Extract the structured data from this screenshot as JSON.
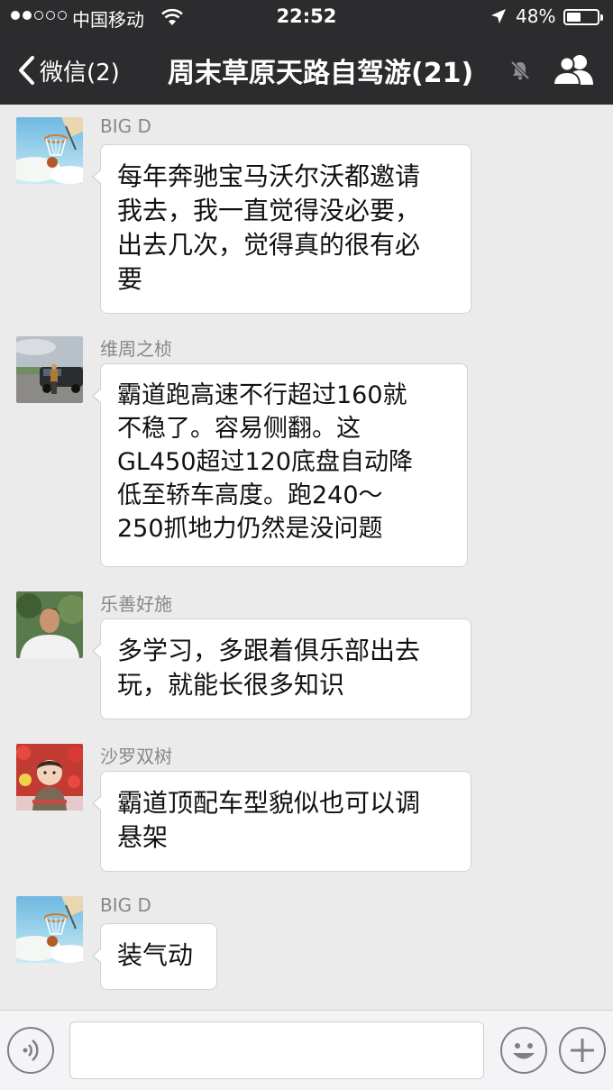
{
  "status_bar": {
    "carrier": "中国移动",
    "time": "22:52",
    "battery": "48%",
    "battery_level": 0.48,
    "signal_bars_filled": 2,
    "signal_bars_total": 5
  },
  "nav": {
    "back_label": "微信(2)",
    "title": "周末草原天路自驾游(21)",
    "icons": [
      "chevron-left-icon",
      "mute-bell-icon",
      "group-members-icon"
    ]
  },
  "messages": [
    {
      "sender": "BIG D",
      "text": "每年奔驰宝马沃尔沃都邀请\n我去，我一直觉得没必要，\n出去几次，觉得真的很有必\n要",
      "avatar": "basketball-hoop-avatar"
    },
    {
      "sender": "维周之桢",
      "text": "霸道跑高速不行超过160就\n不稳了。容易侧翻。这\nGL450超过120底盘自动降\n低至轿车高度。跑240～\n250抓地力仍然是没问题",
      "avatar": "man-with-car-avatar"
    },
    {
      "sender": "乐善好施",
      "text": "多学习，多跟着俱乐部出去\n玩，就能长很多知识",
      "avatar": "man-portrait-avatar"
    },
    {
      "sender": "沙罗双树",
      "text": "霸道顶配车型貌似也可以调\n悬架",
      "avatar": "baby-flowers-avatar"
    },
    {
      "sender": "BIG D",
      "text": "装气动",
      "avatar": "basketball-hoop-avatar"
    }
  ],
  "input_bar": {
    "value": "",
    "icons": [
      "voice-icon",
      "emoji-icon",
      "plus-icon"
    ]
  },
  "colors": {
    "header_bg": "#2c2c2e",
    "chat_bg": "#ebebeb",
    "bubble_bg": "#ffffff"
  }
}
